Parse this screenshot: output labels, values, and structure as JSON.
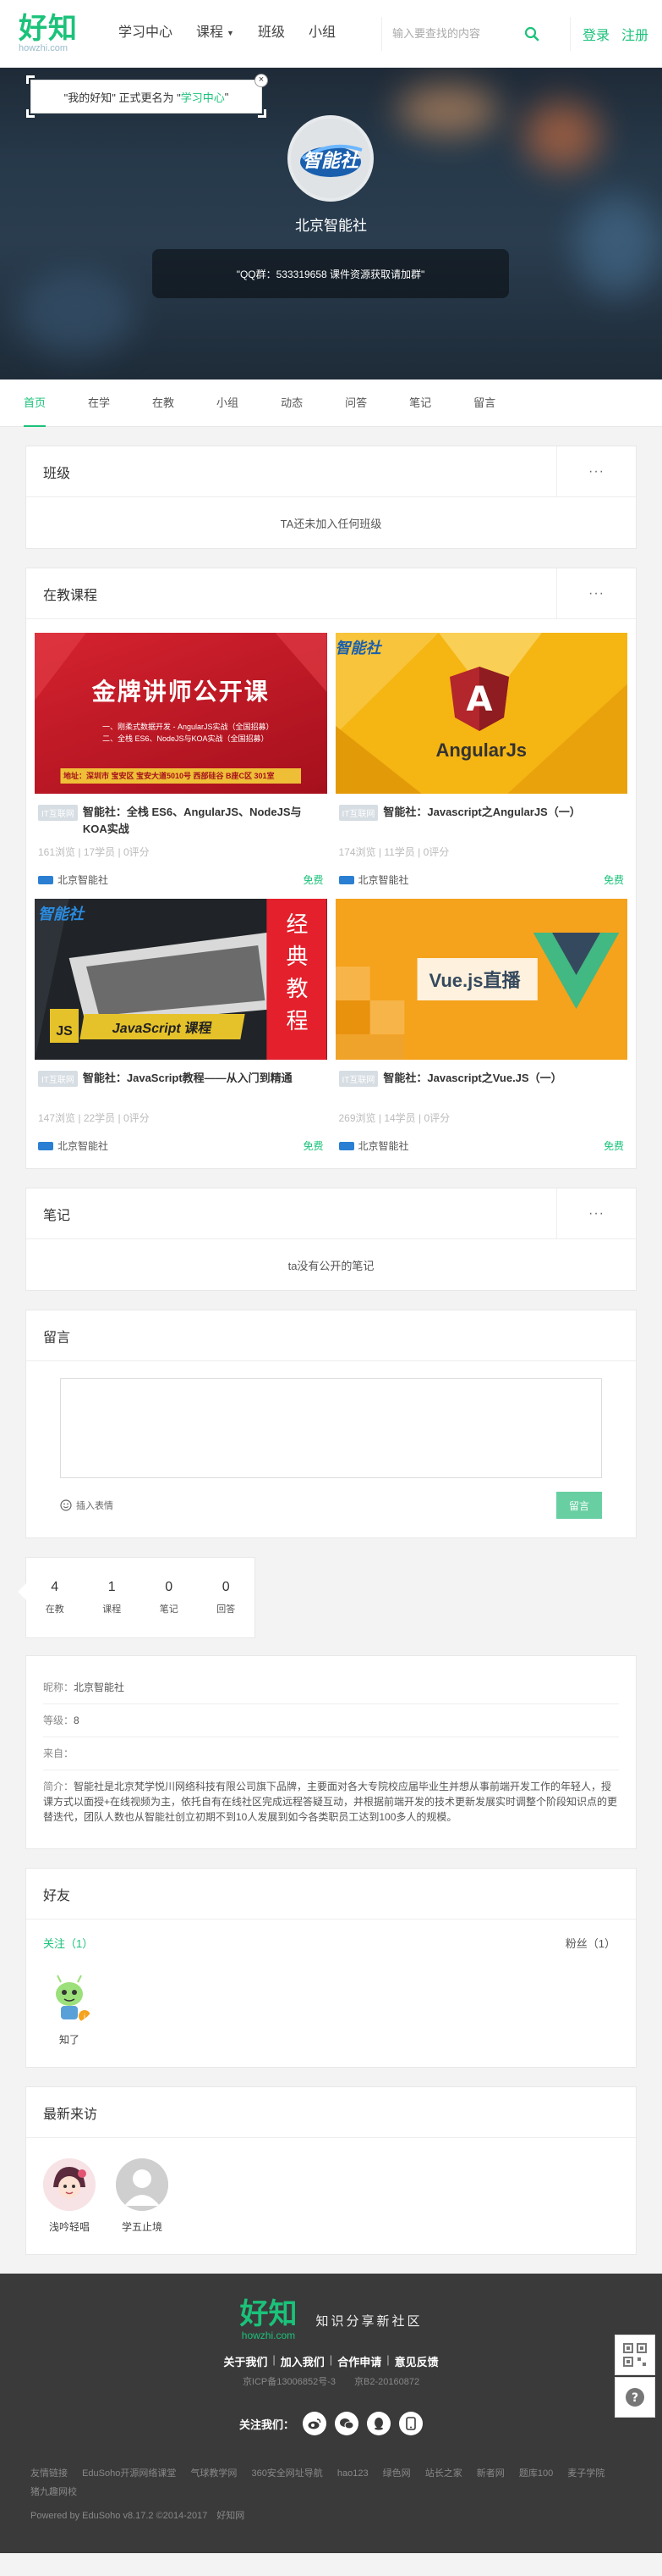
{
  "header": {
    "logo": "好知",
    "logo_sub": "howzhi.com",
    "nav": [
      "学习中心",
      "课程",
      "班级",
      "小组"
    ],
    "search_placeholder": "输入要查找的内容",
    "login": "登录",
    "register": "注册"
  },
  "banner": {
    "tip_prefix": "\"我的好知\" 正式更名为 \"",
    "tip_highlight": "学习中心",
    "tip_suffix": "\"",
    "tip_close": "×",
    "org_name": "北京智能社",
    "signature": "\"QQ群：533319658 课件资源获取请加群\""
  },
  "tabs": [
    "首页",
    "在学",
    "在教",
    "小组",
    "动态",
    "问答",
    "笔记",
    "留言"
  ],
  "classes": {
    "title": "班级",
    "more": "···",
    "empty": "TA还未加入任何班级"
  },
  "teaching": {
    "title": "在教课程",
    "more": "···",
    "courses": [
      {
        "tag": "IT互联网",
        "title": "智能社：全栈 ES6、AngularJS、NodeJS与KOA实战",
        "views": "161浏览",
        "students": "17学员",
        "score": "0评分",
        "org": "北京智能社",
        "price": "免费",
        "thumb_text": "金牌讲师公开课",
        "thumb_lines": [
          "一、刚柔式数据开发 - AngularJS实战（全国招募）",
          "二、全栈 ES6、NodeJS与KOA实战（全国招募）",
          "地址：深圳市 宝安区 宝安大道5010号 西部硅谷 B座C区 301室"
        ],
        "colors": {
          "bg": "#c8182a",
          "accent": "#f5d23a"
        }
      },
      {
        "tag": "IT互联网",
        "title": "智能社：Javascript之AngularJS（一）",
        "views": "174浏览",
        "students": "11学员",
        "score": "0评分",
        "org": "北京智能社",
        "price": "免费",
        "thumb_text": "AngularJs",
        "colors": {
          "bg": "#f5b512",
          "accent": "#b3262b"
        }
      },
      {
        "tag": "IT互联网",
        "title": "智能社：JavaScript教程——从入门到精通",
        "views": "147浏览",
        "students": "22学员",
        "score": "0评分",
        "org": "北京智能社",
        "price": "免费",
        "thumb_text": "JavaScript 课程",
        "thumb_badge": "JS",
        "thumb_side": [
          "经",
          "典",
          "教",
          "程"
        ],
        "colors": {
          "bg": "#202428",
          "accent": "#e6c22a"
        }
      },
      {
        "tag": "IT互联网",
        "title": "智能社：Javascript之Vue.JS（一）",
        "views": "269浏览",
        "students": "14学员",
        "score": "0评分",
        "org": "北京智能社",
        "price": "免费",
        "thumb_text": "Vue.js直播",
        "colors": {
          "bg": "#f5a21c",
          "accent": "#42b883"
        }
      }
    ]
  },
  "notes": {
    "title": "笔记",
    "more": "···",
    "empty": "ta没有公开的笔记"
  },
  "comments": {
    "title": "留言",
    "emoji": "插入表情",
    "submit": "留言"
  },
  "stats": [
    {
      "num": "4",
      "label": "在教"
    },
    {
      "num": "1",
      "label": "课程"
    },
    {
      "num": "0",
      "label": "笔记"
    },
    {
      "num": "0",
      "label": "回答"
    }
  ],
  "profile": {
    "nickname_k": "昵称：",
    "nickname_v": "北京智能社",
    "level_k": "等级：",
    "level_v": "8",
    "from_k": "来自：",
    "from_v": "",
    "intro_k": "简介：",
    "intro_v": "智能社是北京梵学悦川网络科技有限公司旗下品牌，主要面对各大专院校应届毕业生并想从事前端开发工作的年轻人，授课方式以面授+在线视频为主，依托自有在线社区完成远程答疑互动，并根据前端开发的技术更新发展实时调整个阶段知识点的更替迭代，团队人数也从智能社创立初期不到10人发展到如今各类职员工达到100多人的规模。"
  },
  "friends": {
    "title": "好友",
    "following": "关注（1）",
    "followers": "粉丝（1）",
    "list": [
      {
        "name": "知了"
      }
    ]
  },
  "visitors": {
    "title": "最新来访",
    "list": [
      {
        "name": "浅吟轻唱"
      },
      {
        "name": "学五止境"
      }
    ]
  },
  "footer": {
    "logo": "好知",
    "logo_sub": "howzhi.com",
    "slogan": "知识分享新社区",
    "links": [
      "关于我们",
      "加入我们",
      "合作申请",
      "意见反馈"
    ],
    "icp": "京ICP备13006852号-3　　京B2-20160872",
    "follow": "关注我们：",
    "friend_links_label": "友情链接",
    "friend_links": [
      "EduSoho开源网络课堂",
      "气球教学网",
      "360安全网址导航",
      "hao123",
      "绿色网",
      "站长之家",
      "新者网",
      "题库100",
      "麦子学院",
      "猪九趣网校"
    ],
    "powered": "Powered by EduSoho v8.17.2 ©2014-2017　好知网"
  },
  "colors": {
    "brand": "#1bc27a",
    "footer_bg": "#3a3a3a"
  }
}
